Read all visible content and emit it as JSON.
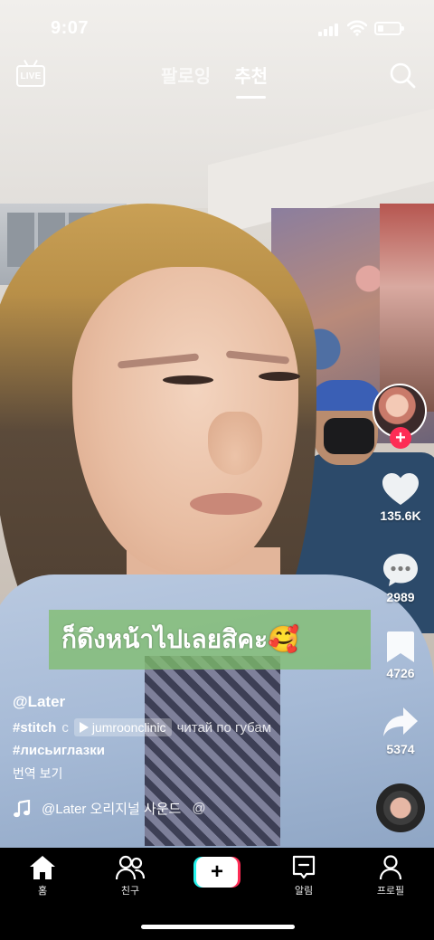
{
  "status_bar": {
    "time": "9:07",
    "battery_level": 0.25
  },
  "top_bar": {
    "live_label": "LIVE",
    "tabs": [
      {
        "label": "팔로잉",
        "active": false
      },
      {
        "label": "추천",
        "active": true
      }
    ]
  },
  "actions": {
    "likes": "135.6K",
    "comments": "2989",
    "saves": "4726",
    "shares": "5374"
  },
  "video": {
    "overlay_caption": "ก็ดึงหน้าไปเลยสิคะ🥰"
  },
  "post": {
    "username": "@Later",
    "hashtag_stitch": "#stitch",
    "stitch_connector": "с",
    "stitched_account": "jumroonclinic",
    "stitch_text": "читай по губам",
    "hashtag_second": "#лисьиглазки",
    "translate_label": "번역 보기",
    "sound_text": "@Later 오리지널 사운드",
    "sound_trailing": "@"
  },
  "bottom_nav": {
    "home": "홈",
    "friends": "친구",
    "create": "+",
    "inbox": "알림",
    "profile": "프로필"
  },
  "colors": {
    "accent_red": "#fe2c55",
    "accent_cyan": "#25f4ee",
    "overlay_green": "#80be6e"
  },
  "icons": [
    "live-icon",
    "search-icon",
    "heart-icon",
    "comment-icon",
    "bookmark-icon",
    "share-icon",
    "music-note-icon",
    "home-icon",
    "friends-icon",
    "inbox-icon",
    "profile-icon"
  ]
}
